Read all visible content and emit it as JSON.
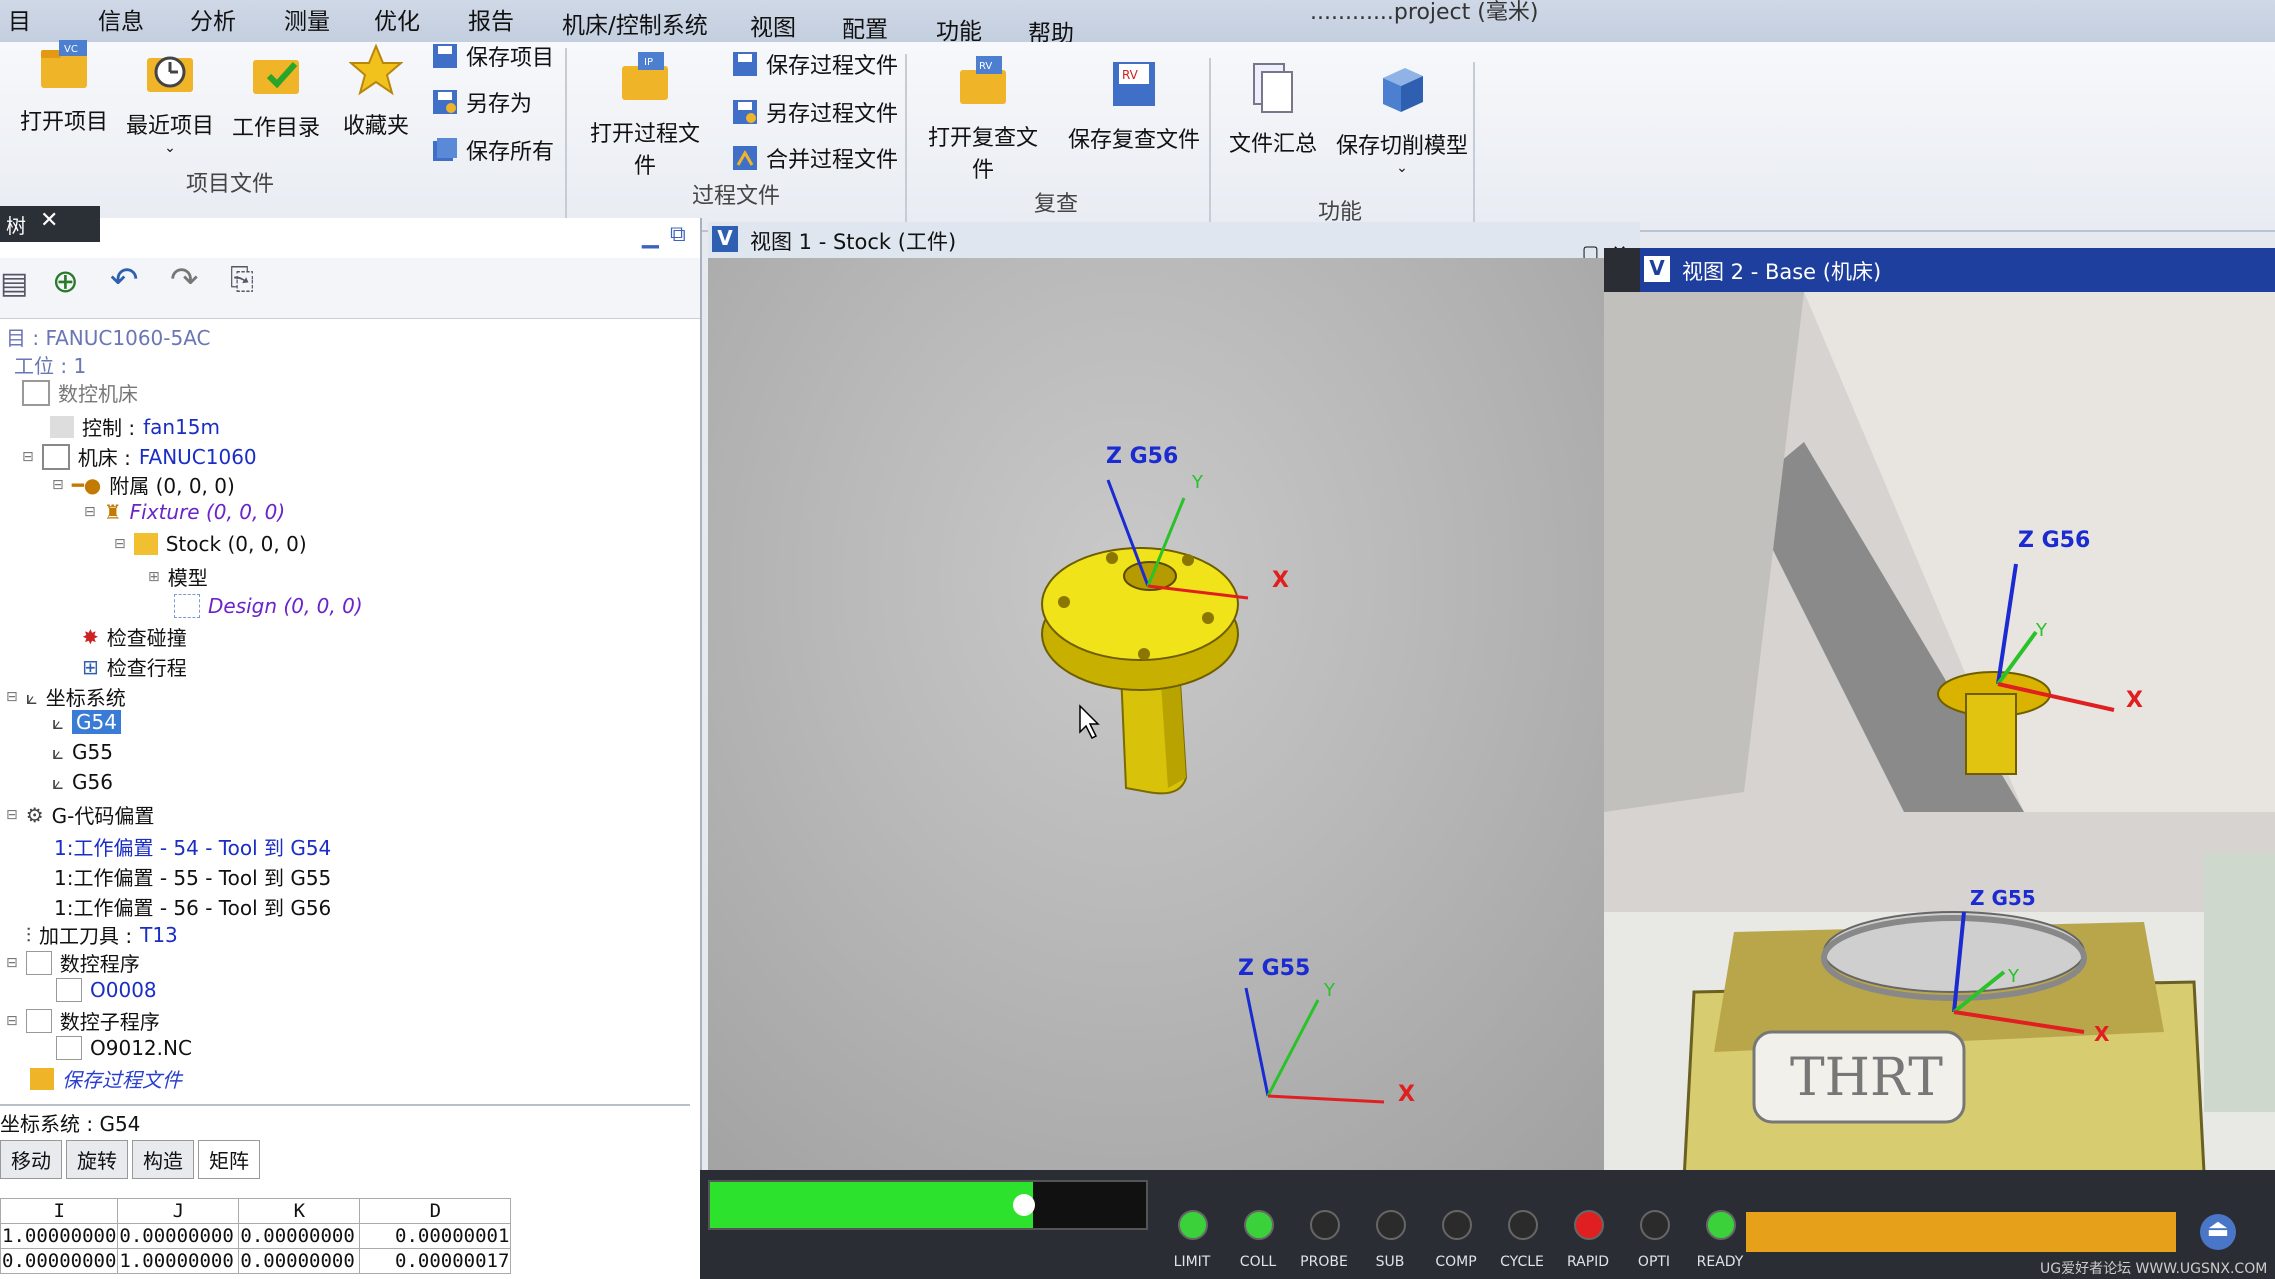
{
  "menu": {
    "items": [
      "目",
      "信息",
      "分析",
      "测量",
      "优化",
      "报告",
      "机床/控制系统",
      "视图",
      "配置",
      "功能",
      "帮助"
    ],
    "title_text": "............project (毫米)"
  },
  "ribbon": {
    "project_group_label": "项目文件",
    "open_project": "打开项目",
    "recent_project": "最近项目",
    "work_dir": "工作目录",
    "favorites": "收藏夹",
    "save_project": "保存项目",
    "save_as": "另存为",
    "save_all": "保存所有",
    "process_group_label": "过程文件",
    "open_process": "打开过程文件",
    "save_process": "保存过程文件",
    "save_process_as": "另存过程文件",
    "merge_process": "合并过程文件",
    "review_group_label": "复查",
    "open_review": "打开复查文件",
    "save_review": "保存复查文件",
    "func_group_label": "功能",
    "file_summary": "文件汇总",
    "save_cut_model": "保存切削模型"
  },
  "panel": {
    "tab_label": "树",
    "tree": {
      "project": "目 : FANUC1060-5AC",
      "setup": "工位 : 1",
      "machine_root": "数控机床",
      "control": "控制 : ",
      "control_value": "fan15m",
      "machine": "机床 : ",
      "machine_value": "FANUC1060",
      "attach": "附属 (0, 0, 0)",
      "fixture": "Fixture (0, 0, 0)",
      "stock": "Stock (0, 0, 0)",
      "model": "模型",
      "design": "Design (0, 0, 0)",
      "collision": "检查碰撞",
      "travel": "检查行程",
      "coord_sys": "坐标系统",
      "g54": "G54",
      "g55": "G55",
      "g56": "G56",
      "gcode_offsets": "G-代码偏置",
      "offset1": "1:工作偏置 - 54 - Tool 到 G54",
      "offset2": "1:工作偏置 - 55 - Tool 到 G55",
      "offset3": "1:工作偏置 - 56 - Tool 到 G56",
      "tool": "加工刀具 : ",
      "tool_value": "T13",
      "nc_program": "数控程序",
      "nc_value": "O0008",
      "subprogram": "数控子程序",
      "sub_value": "O9012.NC",
      "save_process": "保存过程文件"
    },
    "coord_label": "坐标系统 : G54",
    "tabs": [
      "移动",
      "旋转",
      "构造",
      "矩阵"
    ],
    "matrix_headers": [
      "I",
      "J",
      "K",
      "D"
    ],
    "matrix_rows": [
      [
        "1.00000000",
        "0.00000000",
        "0.00000000",
        "0.00000001"
      ],
      [
        "0.00000000",
        "1.00000000",
        "0.00000000",
        "0.00000017"
      ]
    ]
  },
  "viewport1": {
    "title": "视图 1 - Stock (工件)",
    "axis_z": "Z G56",
    "axis_y": "Y",
    "axis_x": "X",
    "axis2_z": "Z G55",
    "axis2_y": "Y",
    "axis2_x": "X"
  },
  "viewport2": {
    "title": "视图 2 - Base (机床)",
    "axis_z": "Z G56",
    "axis_y": "Y",
    "axis_x": "X",
    "axis2_z": "Z G55",
    "axis2_y": "Y",
    "axis2_x": "X",
    "machine_logo": "THRT"
  },
  "status": {
    "progress": 0.74,
    "indicators": [
      {
        "label": "LIMIT",
        "color": "#3bd13b"
      },
      {
        "label": "COLL",
        "color": "#3bd13b"
      },
      {
        "label": "PROBE",
        "color": "#2b2b2b"
      },
      {
        "label": "SUB",
        "color": "#2b2b2b"
      },
      {
        "label": "COMP",
        "color": "#2b2b2b"
      },
      {
        "label": "CYCLE",
        "color": "#2b2b2b"
      },
      {
        "label": "RAPID",
        "color": "#e02020"
      },
      {
        "label": "OPTI",
        "color": "#2b2b2b"
      },
      {
        "label": "READY",
        "color": "#3bd13b"
      }
    ],
    "watermark": "UG爱好者论坛 WWW.UGSNX.COM"
  }
}
